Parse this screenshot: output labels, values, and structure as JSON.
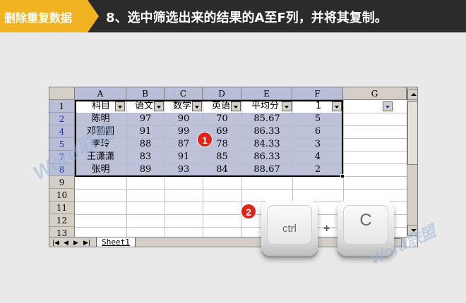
{
  "banner": {
    "tag": "删除重复数据",
    "title": "8、选中筛选出来的结果的A至F列，并将其复制。"
  },
  "sheet": {
    "columns": [
      "A",
      "B",
      "C",
      "D",
      "E",
      "F",
      "G"
    ],
    "rows": [
      "1",
      "2",
      "4",
      "5",
      "7",
      "8",
      "9",
      "10",
      "11",
      "12",
      "13"
    ],
    "headers": [
      "科目",
      "语文",
      "数学",
      "英语",
      "平均分",
      "1"
    ],
    "data": [
      [
        "陈明",
        "97",
        "90",
        "70",
        "85.67",
        "5"
      ],
      [
        "邓圆圆",
        "91",
        "99",
        "69",
        "86.33",
        "6"
      ],
      [
        "李玲",
        "88",
        "87",
        "78",
        "84.33",
        "3"
      ],
      [
        "王潇潇",
        "83",
        "91",
        "85",
        "86.33",
        "4"
      ],
      [
        "张明",
        "89",
        "93",
        "84",
        "88.67",
        "2"
      ]
    ],
    "tab": "Sheet1",
    "tabnav": [
      "|◀",
      "◀",
      "▶",
      "▶|"
    ]
  },
  "badges": {
    "step1": "1",
    "step2": "2"
  },
  "keys": {
    "ctrl": "ctrl",
    "plus": "+",
    "c": "C"
  },
  "watermark": "Word联盟",
  "colors": {
    "banner_bg": "#2b2b2b",
    "tag_bg": "#f2b322",
    "selection": "#b4bad3",
    "badge": "#e2231a"
  }
}
